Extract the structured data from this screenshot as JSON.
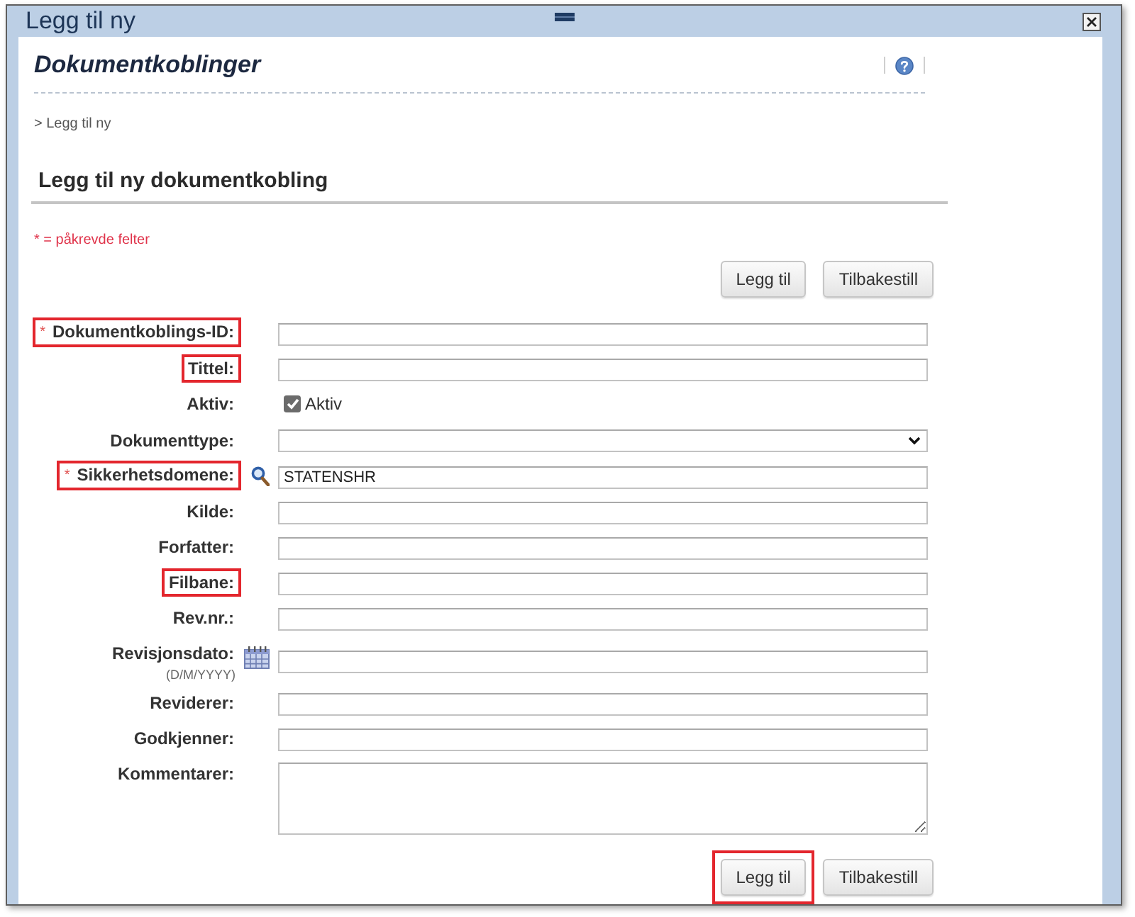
{
  "window": {
    "title": "Legg til ny"
  },
  "header": {
    "title": "Dokumentkoblinger",
    "breadcrumb": "> Legg til ny"
  },
  "section": {
    "title": "Legg til ny dokumentkobling",
    "required_note": "* = påkrevde felter"
  },
  "top_buttons": [
    {
      "label": "Legg til",
      "highlighted": false
    },
    {
      "label": "Tilbakestill",
      "highlighted": false
    }
  ],
  "fields": [
    {
      "kind": "text",
      "required_mark": "*",
      "label": "Dokumentkoblings-ID:",
      "highlighted": true
    },
    {
      "kind": "text",
      "label": "Tittel:",
      "highlighted": true
    },
    {
      "kind": "checkbox",
      "label": "Aktiv:",
      "option": "Aktiv",
      "checked": true,
      "highlighted": false
    },
    {
      "kind": "select",
      "label": "Dokumenttype:",
      "highlighted": false
    },
    {
      "kind": "lookup",
      "required_mark": "*",
      "label": "Sikkerhetsdomene:",
      "value": "STATENSHR",
      "highlighted": true
    },
    {
      "kind": "text",
      "label": "Kilde:",
      "highlighted": false
    },
    {
      "kind": "text",
      "label": "Forfatter:",
      "highlighted": false
    },
    {
      "kind": "text",
      "label": "Filbane:",
      "highlighted": true
    },
    {
      "kind": "text",
      "label": "Rev.nr.:",
      "highlighted": false
    },
    {
      "kind": "date",
      "label": "Revisjonsdato:",
      "hint": "(D/M/YYYY)",
      "highlighted": false
    },
    {
      "kind": "text",
      "label": "Reviderer:",
      "highlighted": false
    },
    {
      "kind": "text",
      "label": "Godkjenner:",
      "highlighted": false
    },
    {
      "kind": "textarea",
      "label": "Kommentarer:",
      "highlighted": false
    }
  ],
  "bottom_buttons": [
    {
      "label": "Legg til",
      "highlighted": true
    },
    {
      "label": "Tilbakestill",
      "highlighted": false
    }
  ]
}
